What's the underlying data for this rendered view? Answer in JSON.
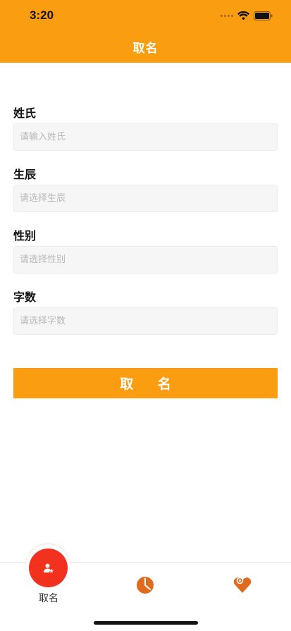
{
  "status_bar": {
    "time": "3:20"
  },
  "header": {
    "title": "取名"
  },
  "form": {
    "fields": [
      {
        "label": "姓氏",
        "placeholder": "请输入姓氏"
      },
      {
        "label": "生辰",
        "placeholder": "请选择生辰"
      },
      {
        "label": "性别",
        "placeholder": "请选择性别"
      },
      {
        "label": "字数",
        "placeholder": "请选择字数"
      }
    ],
    "submit_label": "取 名"
  },
  "tabbar": {
    "items": [
      {
        "label": "取名",
        "icon": "user-star-icon",
        "active": true
      },
      {
        "label": "",
        "icon": "pie-chart-icon"
      },
      {
        "label": "",
        "icon": "heart-pin-icon"
      }
    ]
  },
  "colors": {
    "accent": "#fb9d11",
    "tab_active": "#f3311f",
    "tab_icon": "#e06a1d"
  }
}
